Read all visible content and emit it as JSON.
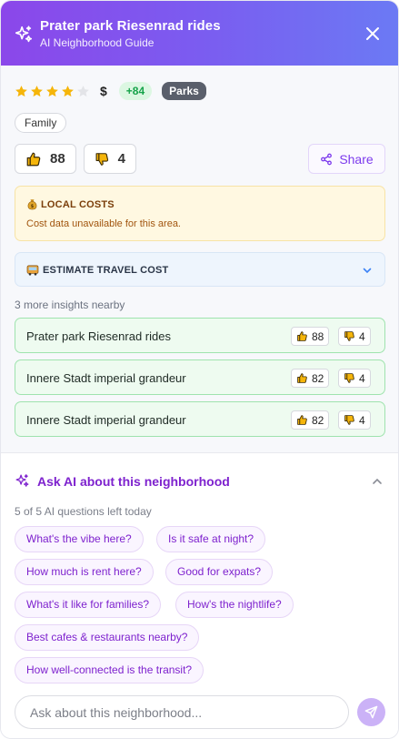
{
  "header": {
    "title": "Prater park Riesenrad rides",
    "subtitle": "AI Neighborhood Guide",
    "icon": "sparkles-icon",
    "close_icon": "close-icon"
  },
  "rating": {
    "stars_filled": 4,
    "stars_total": 5,
    "price": "$",
    "score": "+84",
    "category": "Parks"
  },
  "tag": "Family",
  "votes": {
    "up": "88",
    "down": "4",
    "share_label": "Share"
  },
  "local_costs": {
    "title": "LOCAL COSTS",
    "message": "Cost data unavailable for this area."
  },
  "travel": {
    "title": "ESTIMATE TRAVEL COST"
  },
  "nearby": {
    "label": "3 more insights nearby",
    "items": [
      {
        "name": "Prater park Riesenrad rides",
        "up": "88",
        "down": "4"
      },
      {
        "name": "Innere Stadt imperial grandeur",
        "up": "82",
        "down": "4"
      },
      {
        "name": "Innere Stadt imperial grandeur",
        "up": "82",
        "down": "4"
      }
    ]
  },
  "ask": {
    "title": "Ask AI about this neighborhood",
    "remaining": "5 of 5 AI questions left today",
    "chips": [
      "What's the vibe here?",
      "Is it safe at night?",
      "How much is rent here?",
      "Good for expats?",
      "What's it like for families?",
      "How's the nightlife?",
      "Best cafes & restaurants nearby?",
      "How well-connected is the transit?"
    ],
    "placeholder": "Ask about this neighborhood..."
  },
  "colors": {
    "accent": "#7e22ce",
    "star": "#f5b50a",
    "positive": "#16a34a"
  }
}
